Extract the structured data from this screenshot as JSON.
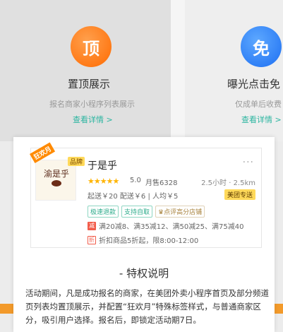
{
  "cards": {
    "left": {
      "icon_text": "顶",
      "title": "置顶展示",
      "desc": "报名商家小程序列表展示",
      "link": "查看详情 >"
    },
    "right": {
      "icon_text": "免",
      "title": "曝光点击免",
      "desc": "仅成单后收费",
      "link": "查看详情 >"
    }
  },
  "shop": {
    "ribbon": "狂欢月",
    "brand_tag": "品牌",
    "logo_text": "渝是乎",
    "name": "于是乎",
    "more": "···",
    "stars": "★★★★★",
    "rating": "5.0",
    "monthly_sales": "月售6328",
    "distance": "2.5小时 · 2.5km",
    "fees": "起送￥20  配送￥6 | 人均￥5",
    "delivery_tag": "美团专送",
    "service_tags": [
      "极速退款",
      "支持自取",
      "点评高分店铺"
    ],
    "promo1_tag": "减",
    "promo1_text": "满20减8、满35减12、满50减25、满75减40",
    "promo2_tag": "折",
    "promo2_text": "折扣商品5折起，限8:00-12:00"
  },
  "popup": {
    "title": "- 特权说明",
    "body": "活动期间，凡是成功报名的商家，在美团外卖小程序首页及部分频道页列表均置顶展示，并配置“狂欢月”特殊标签样式，与普通商家区分，吸引用户选择。报名后，即锁定活动期7日。"
  },
  "colors": {
    "orange": "#ff6a00",
    "blue": "#1d6ff2",
    "teal_link": "#2bb5a0",
    "yellow_tag": "#ffd95a"
  }
}
